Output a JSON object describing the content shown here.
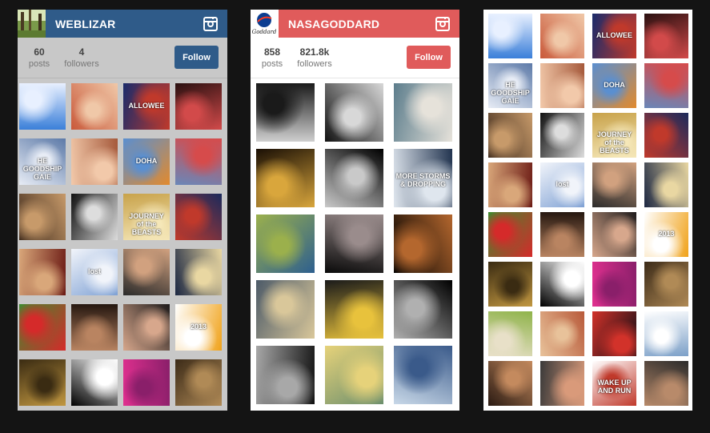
{
  "widgets": [
    {
      "username": "WEBLIZAR",
      "stats": [
        {
          "value": "60",
          "label": "posts"
        },
        {
          "value": "4",
          "label": "followers"
        }
      ],
      "follow_label": "Follow",
      "theme_color": "#2f5b89",
      "background": "#c8c8c8",
      "avatar_icon": "forest-avatar-icon",
      "photos": [
        {
          "subject": "blue butterflies",
          "colors": [
            "#3a7fd9",
            "#e8f0ff"
          ]
        },
        {
          "subject": "woman portrait red hair",
          "colors": [
            "#c9593a",
            "#f0c8a8"
          ]
        },
        {
          "subject": "halloween poster",
          "colors": [
            "#1a2b6b",
            "#c0392b"
          ],
          "caption": "ALLOWEE"
        },
        {
          "subject": "woman in red",
          "colors": [
            "#2a1010",
            "#d24a4a"
          ]
        },
        {
          "subject": "boat on water",
          "colors": [
            "#5d7aa8",
            "#e7ecf5"
          ],
          "caption": "HE GOODSHIP GAIE"
        },
        {
          "subject": "woman portrait",
          "colors": [
            "#a5593b",
            "#f2c9aa"
          ]
        },
        {
          "subject": "doha skyline",
          "colors": [
            "#e28a2d",
            "#5a8fd0"
          ],
          "caption": "DOHA"
        },
        {
          "subject": "woman on pier",
          "colors": [
            "#6a86b8",
            "#d64b4b"
          ]
        },
        {
          "subject": "woman dark hair",
          "colors": [
            "#3e2a1c",
            "#c79a6a"
          ]
        },
        {
          "subject": "woman black white",
          "colors": [
            "#111111",
            "#dddddd"
          ]
        },
        {
          "subject": "journey of the beasts",
          "colors": [
            "#c8a24a",
            "#f5e7b8"
          ],
          "caption": "JOURNEY of the BEASTS"
        },
        {
          "subject": "woman and car",
          "colors": [
            "#1b2a5c",
            "#c0392b"
          ]
        },
        {
          "subject": "couple in red room",
          "colors": [
            "#6b1a14",
            "#d9a77a"
          ]
        },
        {
          "subject": "man by lake",
          "colors": [
            "#7fa1d4",
            "#f1f4fa"
          ],
          "caption": "lost"
        },
        {
          "subject": "woman smiling",
          "colors": [
            "#2b2b2b",
            "#d1a17f"
          ]
        },
        {
          "subject": "blonde woman",
          "colors": [
            "#1c2742",
            "#e9d7a2"
          ]
        },
        {
          "subject": "woman on grass",
          "colors": [
            "#3d8b2f",
            "#d52a2a"
          ]
        },
        {
          "subject": "woman portrait dark",
          "colors": [
            "#24160f",
            "#b98461"
          ]
        },
        {
          "subject": "woman long hair",
          "colors": [
            "#1e1b1b",
            "#d7a78c"
          ]
        },
        {
          "subject": "2013 sheep",
          "colors": [
            "#f0a21a",
            "#ffffff"
          ],
          "caption": "2013"
        },
        {
          "subject": "woman on bike",
          "colors": [
            "#c19740",
            "#3a2b12"
          ]
        },
        {
          "subject": "game console",
          "colors": [
            "#000000",
            "#ffffff"
          ]
        },
        {
          "subject": "pink hair woman",
          "colors": [
            "#e0308f",
            "#8a1f6a"
          ]
        },
        {
          "subject": "woman autumn",
          "colors": [
            "#3c2b18",
            "#b08a56"
          ]
        }
      ]
    },
    {
      "username": "NASAGODDARD",
      "stats": [
        {
          "value": "858",
          "label": "posts"
        },
        {
          "value": "821.8k",
          "label": "followers"
        }
      ],
      "follow_label": "Follow",
      "theme_color": "#e05b5b",
      "background": "#ffffff",
      "avatar_icon": "nasa-logo-icon",
      "avatar_text": "Goddard",
      "photos": [
        {
          "subject": "solar surface",
          "colors": [
            "#cfcfcf",
            "#1a1a1a"
          ]
        },
        {
          "subject": "mirror segments",
          "colors": [
            "#111111",
            "#d8d8d8"
          ]
        },
        {
          "subject": "astronauts on ice",
          "colors": [
            "#5c7d8c",
            "#e6e2da"
          ]
        },
        {
          "subject": "golden lights",
          "colors": [
            "#1a0f05",
            "#d9a63c"
          ]
        },
        {
          "subject": "oval object",
          "colors": [
            "#000000",
            "#c9c9c9"
          ]
        },
        {
          "subject": "earth clouds",
          "colors": [
            "#22344f",
            "#dfe6ee"
          ],
          "caption": "MORE STORMS & DROPPING"
        },
        {
          "subject": "earth colored map",
          "colors": [
            "#2d5f8f",
            "#9bb04c"
          ]
        },
        {
          "subject": "star field",
          "colors": [
            "#0a0a0a",
            "#9a8c8c"
          ]
        },
        {
          "subject": "galaxy merger",
          "colors": [
            "#000000",
            "#b4672e"
          ]
        },
        {
          "subject": "laboratory",
          "colors": [
            "#4c5a68",
            "#d9c79a"
          ]
        },
        {
          "subject": "telescope mirror",
          "colors": [
            "#1a1a1a",
            "#e8c23c"
          ]
        },
        {
          "subject": "elliptical galaxy",
          "colors": [
            "#000000",
            "#b0b0b0"
          ]
        },
        {
          "subject": "globular cluster",
          "colors": [
            "#111111",
            "#a8a8a8"
          ]
        },
        {
          "subject": "map lines",
          "colors": [
            "#6c8f6d",
            "#e6d27a"
          ]
        },
        {
          "subject": "arctic ice",
          "colors": [
            "#c8d8e8",
            "#3a5a8a"
          ]
        }
      ]
    },
    {
      "username": "",
      "background": "#ffffff",
      "photos": [
        {
          "subject": "blue butterflies",
          "colors": [
            "#3a7fd9",
            "#e8f0ff"
          ]
        },
        {
          "subject": "woman portrait red hair",
          "colors": [
            "#c9593a",
            "#f0c8a8"
          ]
        },
        {
          "subject": "halloween poster",
          "colors": [
            "#1a2b6b",
            "#c0392b"
          ],
          "caption": "ALLOWEE"
        },
        {
          "subject": "woman in red",
          "colors": [
            "#2a1010",
            "#d24a4a"
          ]
        },
        {
          "subject": "boat on water",
          "colors": [
            "#5d7aa8",
            "#e7ecf5"
          ],
          "caption": "HE GOODSHIP GAIE"
        },
        {
          "subject": "woman portrait",
          "colors": [
            "#a5593b",
            "#f2c9aa"
          ]
        },
        {
          "subject": "doha skyline",
          "colors": [
            "#e28a2d",
            "#5a8fd0"
          ],
          "caption": "DOHA"
        },
        {
          "subject": "woman on pier",
          "colors": [
            "#6a86b8",
            "#d64b4b"
          ]
        },
        {
          "subject": "woman dark hair",
          "colors": [
            "#3e2a1c",
            "#c79a6a"
          ]
        },
        {
          "subject": "woman black white",
          "colors": [
            "#111111",
            "#dddddd"
          ]
        },
        {
          "subject": "journey of the beasts",
          "colors": [
            "#c8a24a",
            "#f5e7b8"
          ],
          "caption": "JOURNEY of the BEASTS"
        },
        {
          "subject": "woman and car",
          "colors": [
            "#1b2a5c",
            "#c0392b"
          ]
        },
        {
          "subject": "couple in red room",
          "colors": [
            "#6b1a14",
            "#d9a77a"
          ]
        },
        {
          "subject": "man by lake",
          "colors": [
            "#7fa1d4",
            "#f1f4fa"
          ],
          "caption": "lost"
        },
        {
          "subject": "woman smiling",
          "colors": [
            "#2b2b2b",
            "#d1a17f"
          ]
        },
        {
          "subject": "blonde woman",
          "colors": [
            "#1c2742",
            "#e9d7a2"
          ]
        },
        {
          "subject": "woman on grass",
          "colors": [
            "#3d8b2f",
            "#d52a2a"
          ]
        },
        {
          "subject": "woman portrait dark",
          "colors": [
            "#24160f",
            "#b98461"
          ]
        },
        {
          "subject": "woman long hair",
          "colors": [
            "#1e1b1b",
            "#d7a78c"
          ]
        },
        {
          "subject": "2013 sheep",
          "colors": [
            "#f0a21a",
            "#ffffff"
          ],
          "caption": "2013"
        },
        {
          "subject": "woman on bike",
          "colors": [
            "#c19740",
            "#3a2b12"
          ]
        },
        {
          "subject": "game console",
          "colors": [
            "#000000",
            "#ffffff"
          ]
        },
        {
          "subject": "pink hair woman",
          "colors": [
            "#e0308f",
            "#8a1f6a"
          ]
        },
        {
          "subject": "woman autumn",
          "colors": [
            "#3c2b18",
            "#b08a56"
          ]
        },
        {
          "subject": "bicycle field",
          "colors": [
            "#8fb34a",
            "#e8e0c8"
          ]
        },
        {
          "subject": "swimsuit women",
          "colors": [
            "#b85a3a",
            "#e8c29a"
          ]
        },
        {
          "subject": "red planet",
          "colors": [
            "#0c0c14",
            "#d2322a"
          ]
        },
        {
          "subject": "snowy cabin",
          "colors": [
            "#7ca0c8",
            "#ffffff"
          ]
        },
        {
          "subject": "woman with hat",
          "colors": [
            "#2a1a12",
            "#c48a5e"
          ]
        },
        {
          "subject": "group of women",
          "colors": [
            "#3a3a3a",
            "#d99a7a"
          ]
        },
        {
          "subject": "wake up and run",
          "colors": [
            "#ffffff",
            "#c0392b"
          ],
          "caption": "WAKE UP AND RUN"
        },
        {
          "subject": "muscular man",
          "colors": [
            "#2b2b2b",
            "#b88a6a"
          ]
        }
      ]
    }
  ]
}
